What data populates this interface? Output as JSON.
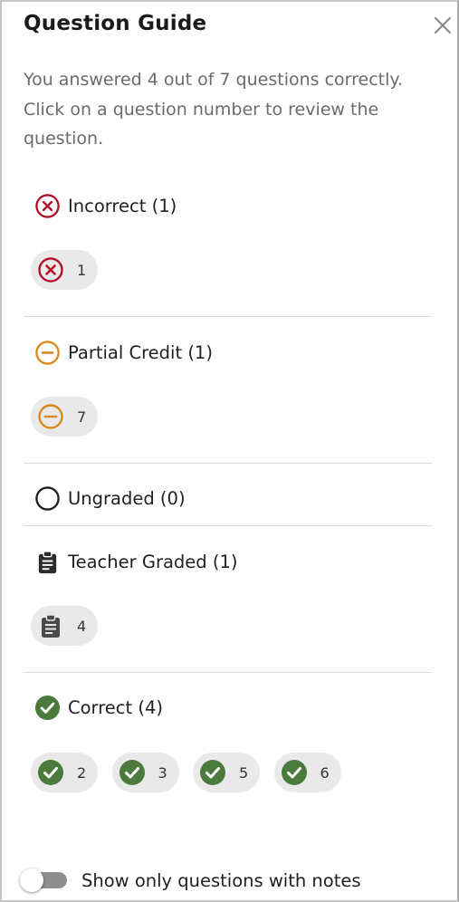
{
  "header": {
    "title": "Question Guide",
    "close_icon": "close-icon"
  },
  "summary": "You answered 4 out of 7 questions correctly. Click on a question number to review the question.",
  "colors": {
    "incorrect": "#b0122b",
    "partial": "#d98a1f",
    "ungraded": "#1f1f1f",
    "teacher": "#2b2b2b",
    "teacher_chip": "#4a4a4a",
    "correct": "#4a7a3c",
    "chip_bg": "#e9e9e9",
    "toggle_off": "#8e8e8e"
  },
  "categories": {
    "incorrect": {
      "label": "Incorrect (1)",
      "icon": "x-circle-icon",
      "questions": [
        "1"
      ]
    },
    "partial": {
      "label": "Partial Credit (1)",
      "icon": "minus-circle-icon",
      "questions": [
        "7"
      ]
    },
    "ungraded": {
      "label": "Ungraded (0)",
      "icon": "empty-circle-icon",
      "questions": []
    },
    "teacher": {
      "label": "Teacher Graded (1)",
      "icon": "clipboard-icon",
      "questions": [
        "4"
      ]
    },
    "correct": {
      "label": "Correct (4)",
      "icon": "check-circle-icon",
      "questions": [
        "2",
        "3",
        "5",
        "6"
      ]
    }
  },
  "footer": {
    "toggle_label": "Show only questions with notes",
    "toggle_on": false
  }
}
